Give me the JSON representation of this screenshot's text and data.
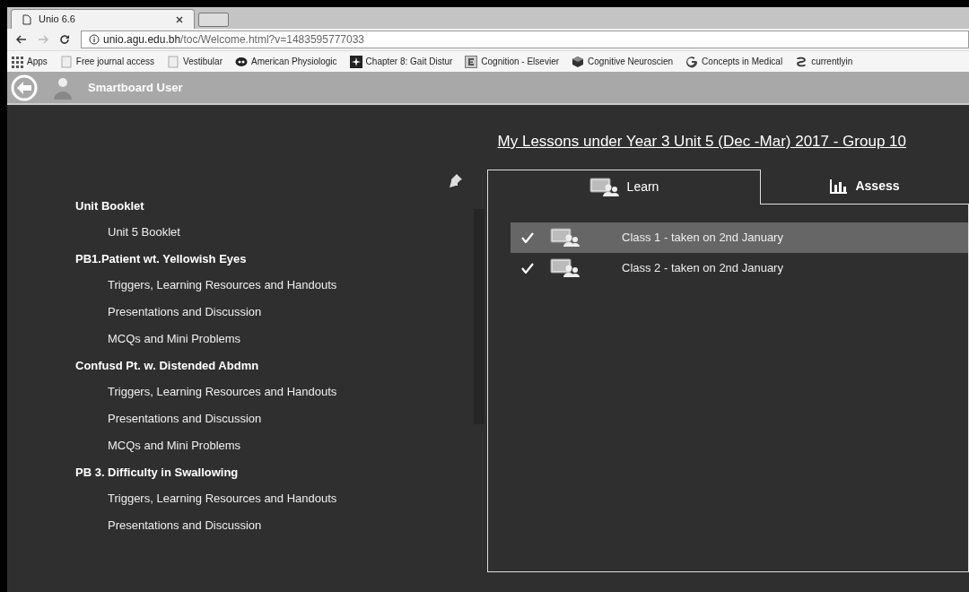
{
  "browser": {
    "tabs": [
      {
        "title": "Unio 6.6",
        "selected": true
      },
      {
        "selected": false
      }
    ],
    "url_host": "unio.agu.edu.bh",
    "url_path": "/toc/Welcome.html?v=1483595777033",
    "bookmarks": [
      {
        "label": "Apps",
        "kind": "apps"
      },
      {
        "label": "Free journal access",
        "kind": "page"
      },
      {
        "label": "Vestibular",
        "kind": "page"
      },
      {
        "label": "American Physiologic",
        "kind": "round"
      },
      {
        "label": "Chapter 8: Gait Distur",
        "kind": "star"
      },
      {
        "label": "Cognition - Elsevier",
        "kind": "letter"
      },
      {
        "label": "Cognitive Neuroscien",
        "kind": "cube"
      },
      {
        "label": "Concepts in Medical",
        "kind": "google"
      },
      {
        "label": "currentlyin",
        "kind": "chain"
      }
    ]
  },
  "header": {
    "user": "Smartboard User"
  },
  "title": "My Lessons under Year 3 Unit 5 (Dec -Mar) 2017 - Group 10",
  "outline": [
    {
      "label": "Unit Booklet",
      "children": [
        {
          "label": "Unit 5 Booklet"
        }
      ]
    },
    {
      "label": "PB1.Patient wt. Yellowish Eyes",
      "children": [
        {
          "label": "Triggers, Learning Resources and Handouts"
        },
        {
          "label": "Presentations and Discussion"
        },
        {
          "label": "MCQs and Mini Problems"
        }
      ]
    },
    {
      "label": "Confusd Pt. w. Distended Abdmn",
      "children": [
        {
          "label": "Triggers, Learning Resources and Handouts"
        },
        {
          "label": "Presentations and Discussion"
        },
        {
          "label": "MCQs and Mini Problems"
        }
      ]
    },
    {
      "label": "PB 3. Difficulty in Swallowing",
      "children": [
        {
          "label": "Triggers, Learning Resources and Handouts"
        },
        {
          "label": "Presentations and Discussion"
        }
      ]
    }
  ],
  "tabs": [
    {
      "label": "Learn",
      "kind": "learn",
      "selected": true
    },
    {
      "label": "Assess",
      "kind": "assess",
      "selected": false
    }
  ],
  "lessons": [
    {
      "label": "Class 1 - taken on 2nd January",
      "checked": true,
      "selected": true
    },
    {
      "label": "Class 2 - taken on 2nd January",
      "checked": true,
      "selected": false
    }
  ]
}
